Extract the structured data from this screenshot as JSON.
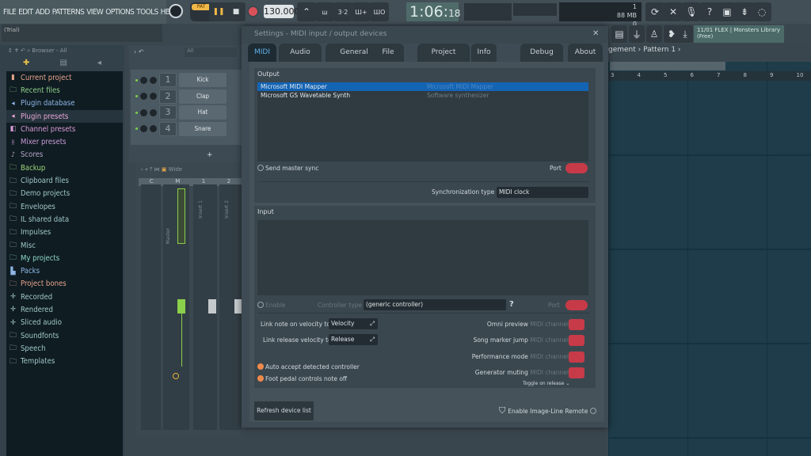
{
  "menu": [
    "FILE",
    "EDIT",
    "ADD",
    "PATTERNS",
    "VIEW",
    "OPTIONS",
    "TOOLS",
    "HELP"
  ],
  "hint_panel": "(Trial)",
  "transport": {
    "pat_song": "PAT",
    "tempo": "130.000",
    "time": "1:06",
    "time_small": "18",
    "time_unit": "M:S:CS"
  },
  "memory": {
    "value": "1",
    "mem": "88 MB",
    "polyphony": "0"
  },
  "news_hint": {
    "line1": "11/01  FLEX | Monsters Library",
    "line2": "(Free)"
  },
  "browser": {
    "header": "Browser - All",
    "items": [
      {
        "label": "Current project",
        "color": "#e8a48c",
        "icon": "doc-icon"
      },
      {
        "label": "Recent files",
        "color": "#8fcf8a",
        "icon": "folder-icon"
      },
      {
        "label": "Plugin database",
        "color": "#8fb7e6",
        "icon": "plug-icon"
      },
      {
        "label": "Plugin presets",
        "color": "#e8a6d6",
        "icon": "plug-icon"
      },
      {
        "label": "Channel presets",
        "color": "#d99ad6",
        "icon": "channel-icon"
      },
      {
        "label": "Mixer presets",
        "color": "#c99ad6",
        "icon": "mixer-icon"
      },
      {
        "label": "Scores",
        "color": "#b7a6c8",
        "icon": "note-icon"
      },
      {
        "label": "Backup",
        "color": "#9fd77a",
        "icon": "folder-icon"
      },
      {
        "label": "Clipboard files",
        "color": "#9fc7c8",
        "icon": "folder-icon"
      },
      {
        "label": "Demo projects",
        "color": "#9fc7c8",
        "icon": "folder-icon"
      },
      {
        "label": "Envelopes",
        "color": "#9fc7c8",
        "icon": "folder-icon"
      },
      {
        "label": "IL shared data",
        "color": "#9fc7c8",
        "icon": "folder-icon"
      },
      {
        "label": "Impulses",
        "color": "#9fc7c8",
        "icon": "folder-icon"
      },
      {
        "label": "Misc",
        "color": "#9fc7c8",
        "icon": "folder-icon"
      },
      {
        "label": "My projects",
        "color": "#8fd7c8",
        "icon": "folder-icon"
      },
      {
        "label": "Packs",
        "color": "#8fb7e6",
        "icon": "packs-icon"
      },
      {
        "label": "Project bones",
        "color": "#e8a48c",
        "icon": "folder-icon"
      },
      {
        "label": "Recorded",
        "color": "#9fc7c8",
        "icon": "audio-icon"
      },
      {
        "label": "Rendered",
        "color": "#9fc7c8",
        "icon": "audio-icon"
      },
      {
        "label": "Sliced audio",
        "color": "#9fc7c8",
        "icon": "audio-icon"
      },
      {
        "label": "Soundfonts",
        "color": "#9fc7c8",
        "icon": "folder-icon"
      },
      {
        "label": "Speech",
        "color": "#9fc7c8",
        "icon": "folder-icon"
      },
      {
        "label": "Templates",
        "color": "#9fc7c8",
        "icon": "folder-icon"
      }
    ]
  },
  "channel_rack": {
    "filter": "All",
    "channels": [
      {
        "num": "1",
        "name": "Kick"
      },
      {
        "num": "2",
        "name": "Clap"
      },
      {
        "num": "3",
        "name": "Hat"
      },
      {
        "num": "4",
        "name": "Snare"
      }
    ]
  },
  "mixer": {
    "preset": "Wide",
    "headers": [
      "C",
      "M",
      "1",
      "2"
    ],
    "tracks": [
      "Master",
      "Insert 1",
      "Insert 2"
    ]
  },
  "dialog": {
    "title": "Settings - MIDI input / output devices",
    "tabs": [
      "MIDI",
      "Audio",
      "General",
      "File",
      "Project",
      "Info",
      "Debug",
      "About"
    ],
    "active_tab": "MIDI",
    "output": {
      "label": "Output",
      "devices": [
        {
          "name": "Microsoft MIDI Mapper",
          "desc": "Microsoft MIDI Mapper",
          "selected": true
        },
        {
          "name": "Microsoft GS Wavetable Synth",
          "desc": "Software synthesizer",
          "selected": false
        }
      ],
      "send_master_sync": "Send master sync",
      "port_label": "Port",
      "sync_type_label": "Synchronization type",
      "sync_type": "MIDI clock"
    },
    "input": {
      "label": "Input",
      "enable": "Enable",
      "controller_type_label": "Controller type",
      "controller_type": "(generic controller)",
      "help": "?",
      "port_label": "Port"
    },
    "link_note_on_label": "Link note on velocity to",
    "link_note_on": "Velocity",
    "link_release_label": "Link release velocity to",
    "link_release": "Release",
    "channels": [
      {
        "label": "Omni preview",
        "suffix": "MIDI channel"
      },
      {
        "label": "Song marker jump",
        "suffix": "MIDI channel"
      },
      {
        "label": "Performance mode",
        "suffix": "MIDI channel"
      },
      {
        "label": "Generator muting",
        "suffix": "MIDI channel"
      }
    ],
    "toggle_on_release": "Toggle on release",
    "auto_accept": "Auto accept detected controller",
    "foot_pedal": "Foot pedal controls note off",
    "refresh": "Refresh device list",
    "remote": "Enable Image-Line Remote"
  },
  "playlist": {
    "breadcrumb": "gement › Pattern 1 ›",
    "ruler": [
      "3",
      "4",
      "5",
      "6",
      "7",
      "8",
      "9",
      "10"
    ]
  },
  "colors": {
    "accent_blue": "#1464b4",
    "port_red": "#c73a48",
    "check_orange": "#ee8a4c",
    "grid": "#1e3c49"
  }
}
